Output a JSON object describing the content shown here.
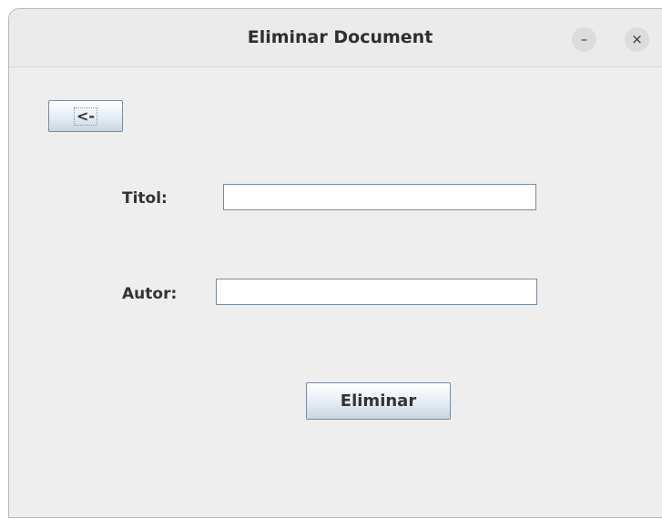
{
  "window": {
    "title": "Eliminar Document",
    "minimize_glyph": "–",
    "close_glyph": "×"
  },
  "back_button": {
    "label": "<-"
  },
  "form": {
    "titol_label": "Titol:",
    "titol_value": "",
    "autor_label": "Autor:",
    "autor_value": ""
  },
  "eliminar_button": {
    "label": "Eliminar"
  },
  "icons": {
    "minimize": "minimize-icon",
    "close": "close-icon"
  }
}
